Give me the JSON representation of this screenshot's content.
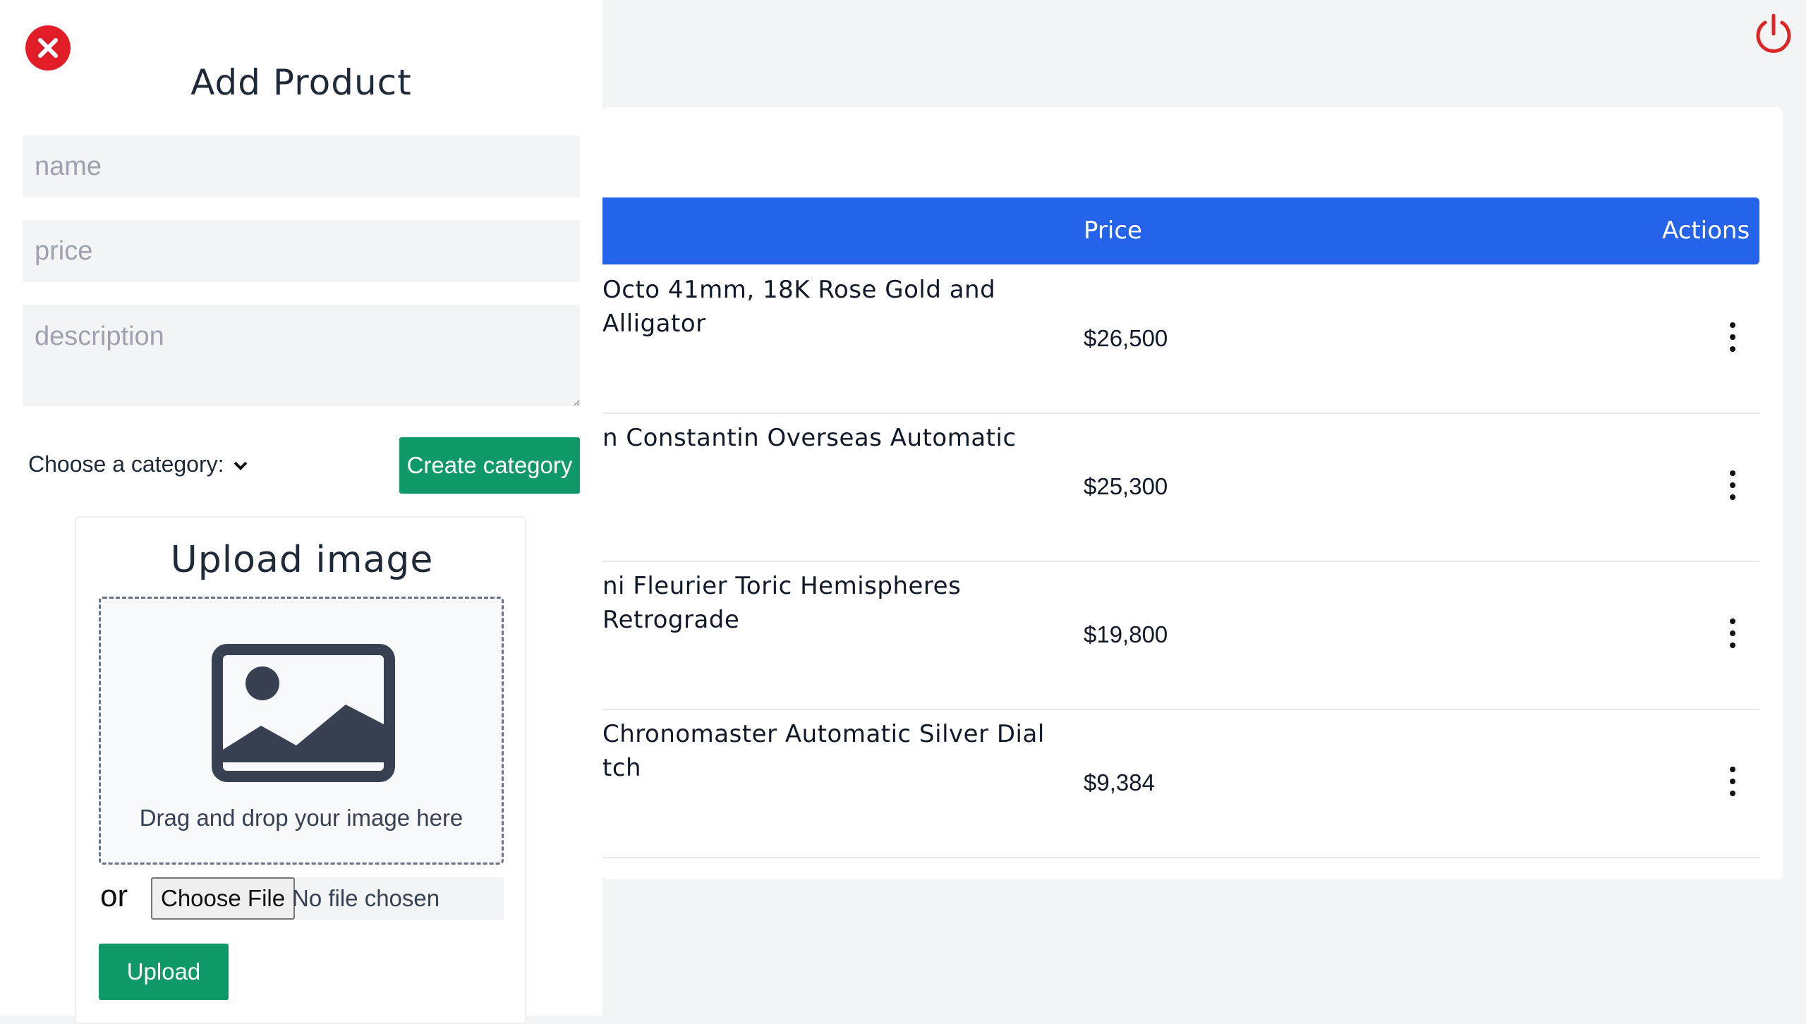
{
  "colors": {
    "accent": "#2563eb",
    "success": "#0f9968",
    "danger": "#e11d2a",
    "power": "#dc2626"
  },
  "header": {
    "power_icon": "power-icon"
  },
  "table": {
    "columns": {
      "price": "Price",
      "actions": "Actions"
    },
    "rows": [
      {
        "name": "Octo 41mm, 18K Rose Gold and Alligator",
        "price": "$26,500"
      },
      {
        "name": "n Constantin Overseas Automatic",
        "price": "$25,300"
      },
      {
        "name": "ni Fleurier Toric Hemispheres Retrograde",
        "price": "$19,800"
      },
      {
        "name": "Chronomaster Automatic Silver Dial\ntch",
        "price": "$9,384"
      }
    ]
  },
  "drawer": {
    "close_icon": "close-icon",
    "title": "Add Product",
    "name_placeholder": "name",
    "price_placeholder": "price",
    "description_placeholder": "description",
    "category_label": "Choose a category:",
    "create_category": "Create category",
    "upload": {
      "title": "Upload image",
      "image_icon": "image-icon",
      "drop_text": "Drag and drop your image here",
      "or": "or",
      "choose_file": "Choose File",
      "no_file": "No file chosen",
      "upload_button": "Upload"
    }
  }
}
